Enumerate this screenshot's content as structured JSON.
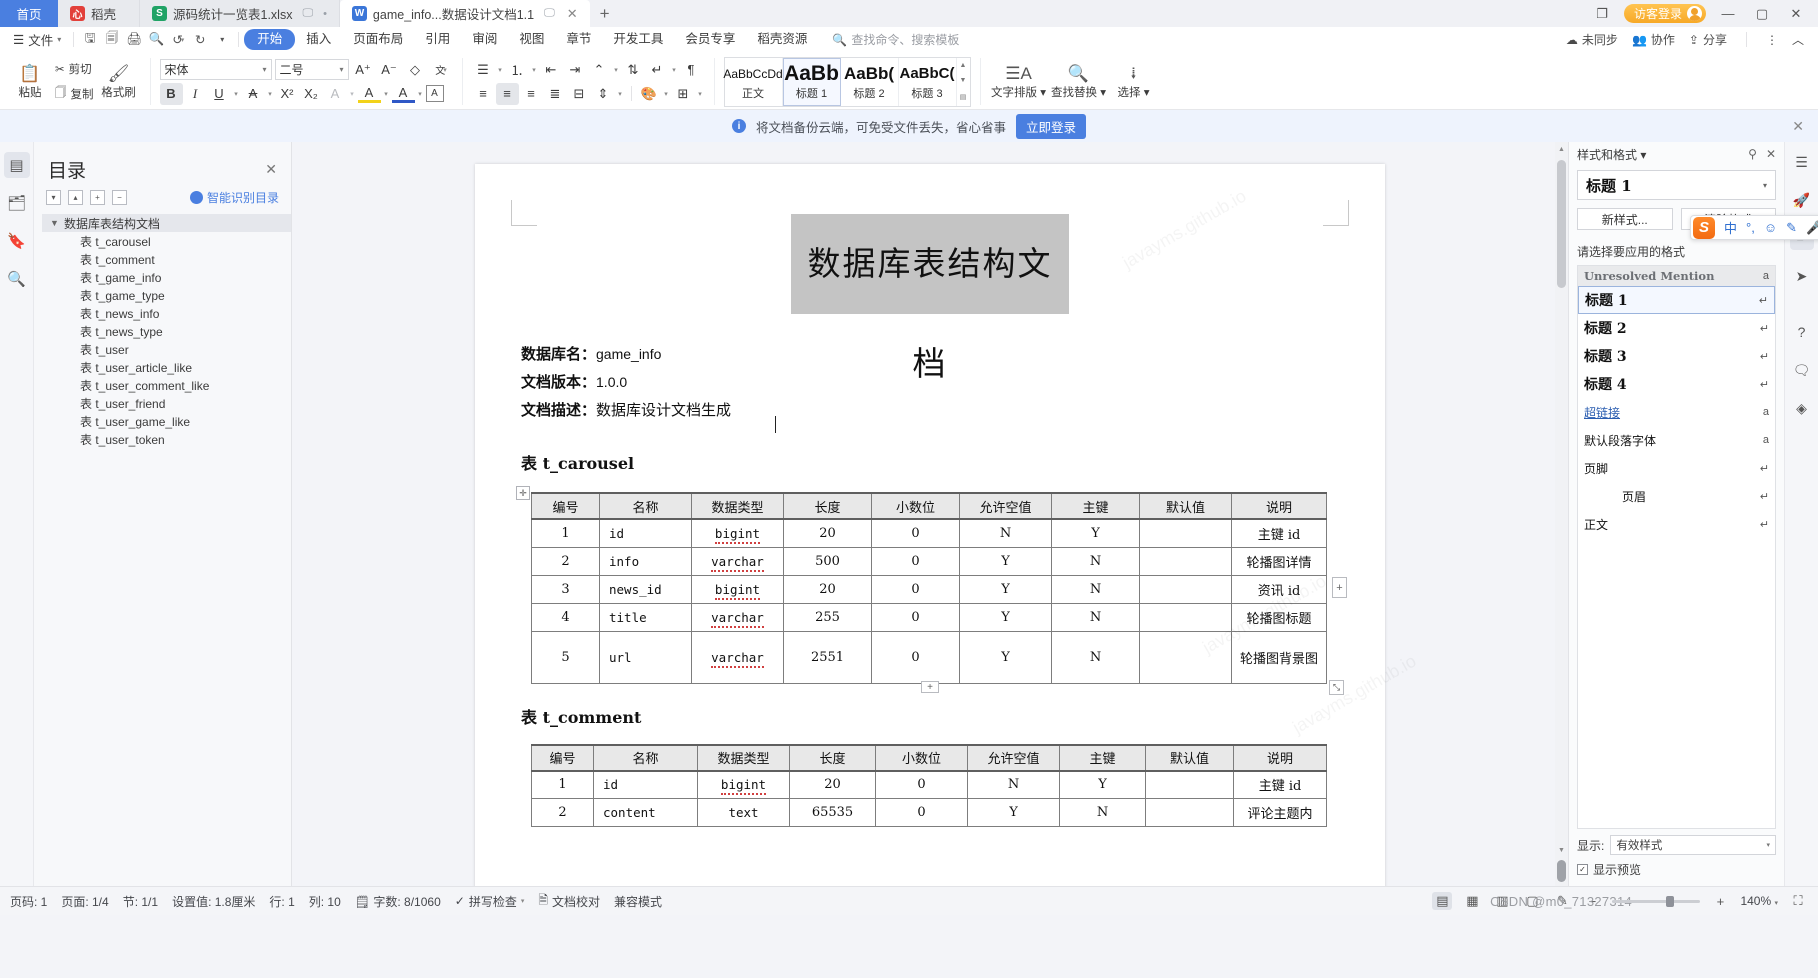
{
  "window": {
    "tabs": [
      {
        "label": "首页",
        "type": "home"
      },
      {
        "label": "稻壳",
        "type": "inactive",
        "icon": "daoke-icon",
        "icon_color": "#e2403a"
      },
      {
        "label": "源码统计一览表1.xlsx",
        "type": "inactive",
        "icon": "excel-icon",
        "icon_color": "#21a366"
      },
      {
        "label": "game_info...数据设计文档1.1",
        "type": "active",
        "icon": "wps-writer-icon",
        "icon_color": "#3b76d8"
      }
    ],
    "new_tab": "+",
    "guest_login": "访客登录",
    "minimize": "—",
    "maximize": "▢",
    "close": "✕"
  },
  "menu": {
    "file_label": "文件",
    "quick_icons": [
      "save-icon",
      "save-as-icon",
      "print-icon",
      "print-preview-icon",
      "undo-icon",
      "redo-icon",
      "customize-icon"
    ],
    "items": [
      "开始",
      "插入",
      "页面布局",
      "引用",
      "审阅",
      "视图",
      "章节",
      "开发工具",
      "会员专享",
      "稻壳资源"
    ],
    "selected": "开始",
    "search_placeholder": "查找命令、搜索模板",
    "right_items": [
      "未同步",
      "协作",
      "分享"
    ],
    "more": "⋮",
    "collapse": "︿"
  },
  "ribbon": {
    "paste": "粘贴",
    "cut": "剪切",
    "copy": "复制",
    "format_painter": "格式刷",
    "font_name": "宋体",
    "font_size": "二号",
    "grow_font": "A⁺",
    "shrink_font": "A⁻",
    "clear_format": "清除格式",
    "pinyin": "拼音指南",
    "bold": "B",
    "italic": "I",
    "underline": "U",
    "strikethrough": "A",
    "superscript": "X²",
    "subscript": "X₂",
    "text_effect": "A",
    "highlight": "A",
    "font_color": "A",
    "char_border": "A",
    "styles": [
      {
        "preview": "AaBbCcDd",
        "name": "正文",
        "selected": false
      },
      {
        "preview": "AaBb",
        "name": "标题 1",
        "selected": true
      },
      {
        "preview": "AaBb(",
        "name": "标题 2",
        "selected": false
      },
      {
        "preview": "AaBbC(",
        "name": "标题 3",
        "selected": false
      }
    ],
    "typography": "文字排版",
    "find_replace": "查找替换",
    "select": "选择"
  },
  "notice": {
    "text": "将文档备份云端，可免受文件丢失，省心省事",
    "button": "立即登录",
    "close": "✕"
  },
  "left_rail": [
    {
      "icon": "outline-icon",
      "selected": true
    },
    {
      "icon": "thumbnail-icon",
      "selected": false
    },
    {
      "icon": "bookmark-icon",
      "selected": false
    },
    {
      "icon": "search-icon",
      "selected": false
    }
  ],
  "nav": {
    "title": "目录",
    "close": "✕",
    "tools": [
      "expand-all-icon",
      "collapse-all-icon",
      "level-up-icon",
      "level-down-icon"
    ],
    "smart_label": "智能识别目录",
    "items": [
      {
        "label": "数据库表结构文档",
        "level": 0,
        "selected": true
      },
      {
        "label": "表 t_carousel",
        "level": 1,
        "selected": false
      },
      {
        "label": "表 t_comment",
        "level": 1,
        "selected": false
      },
      {
        "label": "表 t_game_info",
        "level": 1,
        "selected": false
      },
      {
        "label": "表 t_game_type",
        "level": 1,
        "selected": false
      },
      {
        "label": "表 t_news_info",
        "level": 1,
        "selected": false
      },
      {
        "label": "表 t_news_type",
        "level": 1,
        "selected": false
      },
      {
        "label": "表 t_user",
        "level": 1,
        "selected": false
      },
      {
        "label": "表 t_user_article_like",
        "level": 1,
        "selected": false
      },
      {
        "label": "表 t_user_comment_like",
        "level": 1,
        "selected": false
      },
      {
        "label": "表 t_user_friend",
        "level": 1,
        "selected": false
      },
      {
        "label": "表 t_user_game_like",
        "level": 1,
        "selected": false
      },
      {
        "label": "表 t_user_token",
        "level": 1,
        "selected": false
      }
    ]
  },
  "document": {
    "title": "数据库表结构文档",
    "meta": [
      {
        "label": "数据库名：",
        "value": "game_info"
      },
      {
        "label": "文档版本：",
        "value": "1.0.0"
      },
      {
        "label": "文档描述：",
        "value": "数据库设计文档生成"
      }
    ],
    "watermarks": [
      "javayms.github.io",
      "javayms.github.io",
      "javayms.github.io"
    ],
    "table_headers": [
      "编号",
      "名称",
      "数据类型",
      "长度",
      "小数位",
      "允许空值",
      "主键",
      "默认值",
      "说明"
    ],
    "sections": [
      {
        "heading": "表 t_carousel",
        "rows": [
          {
            "no": "1",
            "name": "id",
            "type": "bigint",
            "len": "20",
            "dec": "0",
            "nullable": "N",
            "pk": "Y",
            "default": "",
            "note": "主键 id"
          },
          {
            "no": "2",
            "name": "info",
            "type": "varchar",
            "len": "500",
            "dec": "0",
            "nullable": "Y",
            "pk": "N",
            "default": "",
            "note": "轮播图详情"
          },
          {
            "no": "3",
            "name": "news_id",
            "type": "bigint",
            "len": "20",
            "dec": "0",
            "nullable": "Y",
            "pk": "N",
            "default": "",
            "note": "资讯 id"
          },
          {
            "no": "4",
            "name": "title",
            "type": "varchar",
            "len": "255",
            "dec": "0",
            "nullable": "Y",
            "pk": "N",
            "default": "",
            "note": "轮播图标题"
          },
          {
            "no": "5",
            "name": "url",
            "type": "varchar",
            "len": "2551",
            "dec": "0",
            "nullable": "Y",
            "pk": "N",
            "default": "",
            "note": "轮播图背景图"
          }
        ]
      },
      {
        "heading": "表 t_comment",
        "rows": [
          {
            "no": "1",
            "name": "id",
            "type": "bigint",
            "len": "20",
            "dec": "0",
            "nullable": "N",
            "pk": "Y",
            "default": "",
            "note": "主键 id"
          },
          {
            "no": "2",
            "name": "content",
            "type": "text",
            "len": "65535",
            "dec": "0",
            "nullable": "Y",
            "pk": "N",
            "default": "",
            "note": "评论主题内"
          }
        ]
      }
    ]
  },
  "styles_pane": {
    "title": "样式和格式",
    "pin": "pin-icon",
    "close": "✕",
    "current_style": "标题 1",
    "new_style_btn": "新样式...",
    "clear_format_btn": "清除格式",
    "prompt": "请选择要应用的格式",
    "list": [
      {
        "name": "Unresolved Mention",
        "kind": "unres",
        "mark": "a"
      },
      {
        "name": "标题 1",
        "kind": "heading",
        "mark": "↵",
        "selected": true
      },
      {
        "name": "标题 2",
        "kind": "heading",
        "mark": "↵"
      },
      {
        "name": "标题 3",
        "kind": "heading",
        "mark": "↵"
      },
      {
        "name": "标题 4",
        "kind": "heading",
        "mark": "↵"
      },
      {
        "name": "超链接",
        "kind": "link",
        "mark": "a"
      },
      {
        "name": "默认段落字体",
        "kind": "plain",
        "mark": "a"
      },
      {
        "name": "页脚",
        "kind": "plain",
        "mark": "↵"
      },
      {
        "name": "页眉",
        "kind": "plain-indent",
        "mark": "↵"
      },
      {
        "name": "正文",
        "kind": "plain",
        "mark": "↵"
      }
    ],
    "show_label": "显示:",
    "show_value": "有效样式",
    "preview_label": "显示预览",
    "preview_checked": true
  },
  "ime": {
    "logo": "S",
    "items": [
      "中",
      "°,",
      "☺",
      "✎",
      "🎤",
      "▦"
    ]
  },
  "right_rail": [
    {
      "icon": "collapse-icon",
      "selected": false
    },
    {
      "icon": "rocket-icon",
      "selected": false
    },
    {
      "icon": "pen-icon",
      "selected": true
    },
    {
      "icon": "cursor-icon",
      "selected": false
    },
    {
      "icon": "help-icon",
      "selected": false
    },
    {
      "icon": "feedback-icon",
      "selected": false
    },
    {
      "icon": "shield-icon",
      "selected": false
    }
  ],
  "status": {
    "page_num": "页码: 1",
    "pages": "页面: 1/4",
    "section": "节: 1/1",
    "indent": "设置值: 1.8厘米",
    "row": "行: 1",
    "col": "列: 10",
    "words": "字数: 8/1060",
    "spellcheck": "拼写检查",
    "proofread": "文档校对",
    "compat": "兼容模式",
    "view_icons": [
      "page-view-icon",
      "outline-view-icon",
      "web-view-icon",
      "reading-view-icon",
      "annotate-icon"
    ],
    "zoom": "140%",
    "zoom_minus": "−",
    "zoom_plus": "+",
    "watermark": "CSDN @m0_71327314"
  }
}
